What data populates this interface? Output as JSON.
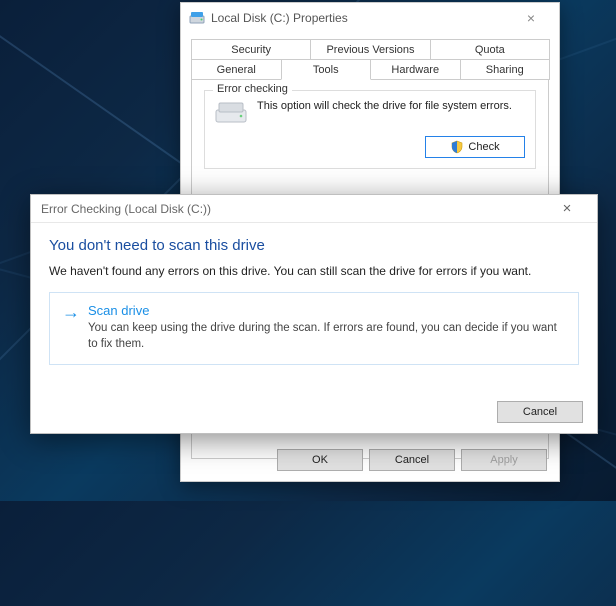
{
  "wallpaper": {
    "accent": "#0d3a5f"
  },
  "props": {
    "title": "Local Disk (C:) Properties",
    "tabs_row1": [
      "Security",
      "Previous Versions",
      "Quota"
    ],
    "tabs_row2": [
      "General",
      "Tools",
      "Hardware",
      "Sharing"
    ],
    "active_tab": "Tools",
    "error_checking": {
      "group_title": "Error checking",
      "description": "This option will check the drive for file system errors.",
      "check_button": "Check"
    },
    "buttons": {
      "ok": "OK",
      "cancel": "Cancel",
      "apply": "Apply"
    }
  },
  "err_dialog": {
    "title": "Error Checking (Local Disk (C:))",
    "heading": "You don't need to scan this drive",
    "subtext": "We haven't found any errors on this drive. You can still scan the drive for errors if you want.",
    "scan": {
      "title": "Scan drive",
      "desc": "You can keep using the drive during the scan. If errors are found, you can decide if you want to fix them."
    },
    "cancel": "Cancel"
  }
}
